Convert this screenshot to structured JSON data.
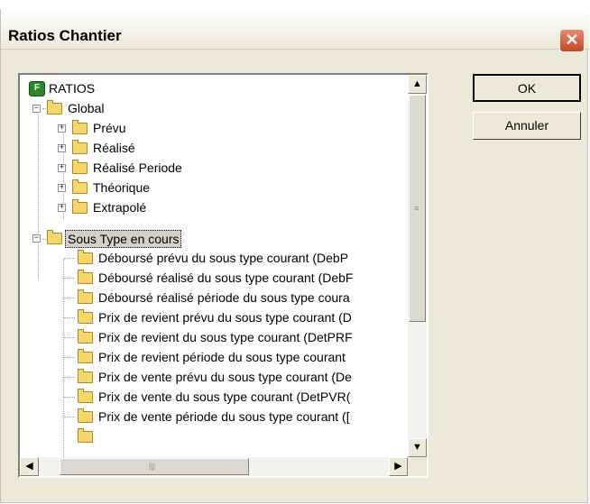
{
  "window": {
    "title": "Ratios Chantier",
    "close_label": "✕"
  },
  "buttons": {
    "ok_label": "OK",
    "cancel_label": "Annuler"
  },
  "tree": {
    "root": "RATIOS",
    "global": {
      "label": "Global",
      "children": [
        "Prévu",
        "Réalisé",
        "Réalisé Periode",
        "Théorique",
        "Extrapolé"
      ]
    },
    "sous_type": {
      "label": "Sous Type en cours",
      "children": [
        "Déboursé prévu du sous type courant (DebP",
        "Déboursé réalisé du sous type courant (DebF",
        "Déboursé réalisé période du sous type coura",
        "Prix de revient prévu du sous type courant (D",
        "Prix de revient du sous type courant (DetPRF",
        "Prix de revient période du sous type courant",
        "Prix de vente prévu du sous type courant (De",
        "Prix de vente du sous type courant (DetPVR(",
        "Prix de vente période du sous type courant (["
      ]
    }
  },
  "scrollbars": {
    "up_arrow": "▲",
    "down_arrow": "▼",
    "left_arrow": "◀",
    "right_arrow": "▶",
    "vertical_position": 0.0,
    "horizontal_position": 0.0
  }
}
